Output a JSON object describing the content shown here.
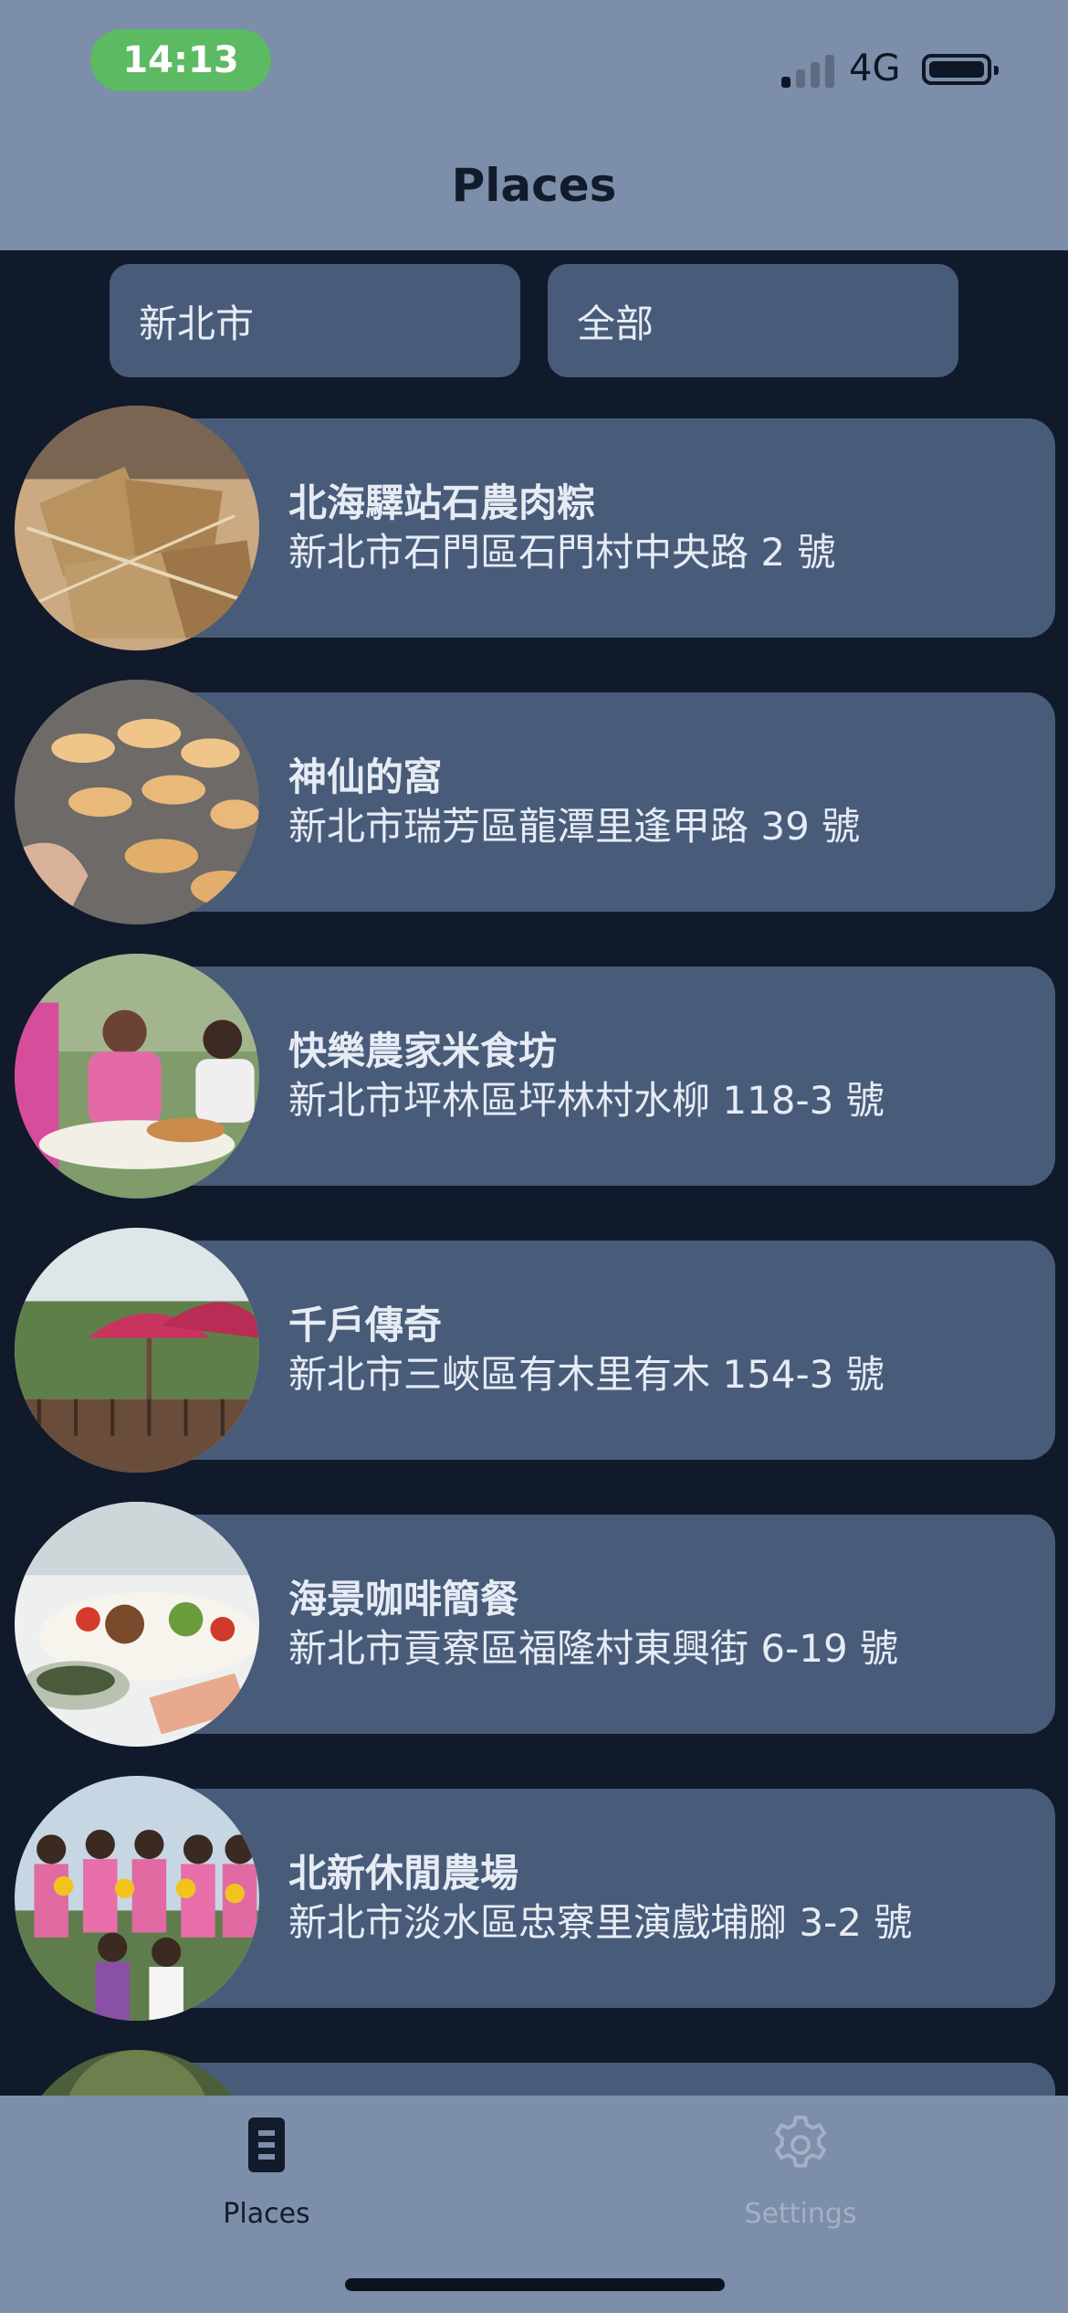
{
  "status_bar": {
    "time": "14:13",
    "network": "4G"
  },
  "header": {
    "title": "Places"
  },
  "filters": {
    "city": "新北市",
    "category": "全部"
  },
  "places": [
    {
      "name": "北海驛站石農肉粽",
      "address": "新北市石門區石門村中央路 2 號",
      "photo": "zongzi"
    },
    {
      "name": "神仙的窩",
      "address": "新北市瑞芳區龍潭里逢甲路 39 號",
      "photo": "pancakes"
    },
    {
      "name": "快樂農家米食坊",
      "address": "新北市坪林區坪林村水柳 118-3 號",
      "photo": "cooking-show"
    },
    {
      "name": "千戶傳奇",
      "address": "新北市三峽區有木里有木 154-3 號",
      "photo": "umbrella-patio"
    },
    {
      "name": "海景咖啡簡餐",
      "address": "新北市貢寮區福隆村東興街 6-19 號",
      "photo": "seafood-meal"
    },
    {
      "name": "北新休閒農場",
      "address": "新北市淡水區忠寮里演戲埔腳 3-2 號",
      "photo": "sunflower-group"
    }
  ],
  "tabbar": {
    "places_label": "Places",
    "settings_label": "Settings",
    "places_icon": "list-icon",
    "settings_icon": "gear-icon"
  }
}
